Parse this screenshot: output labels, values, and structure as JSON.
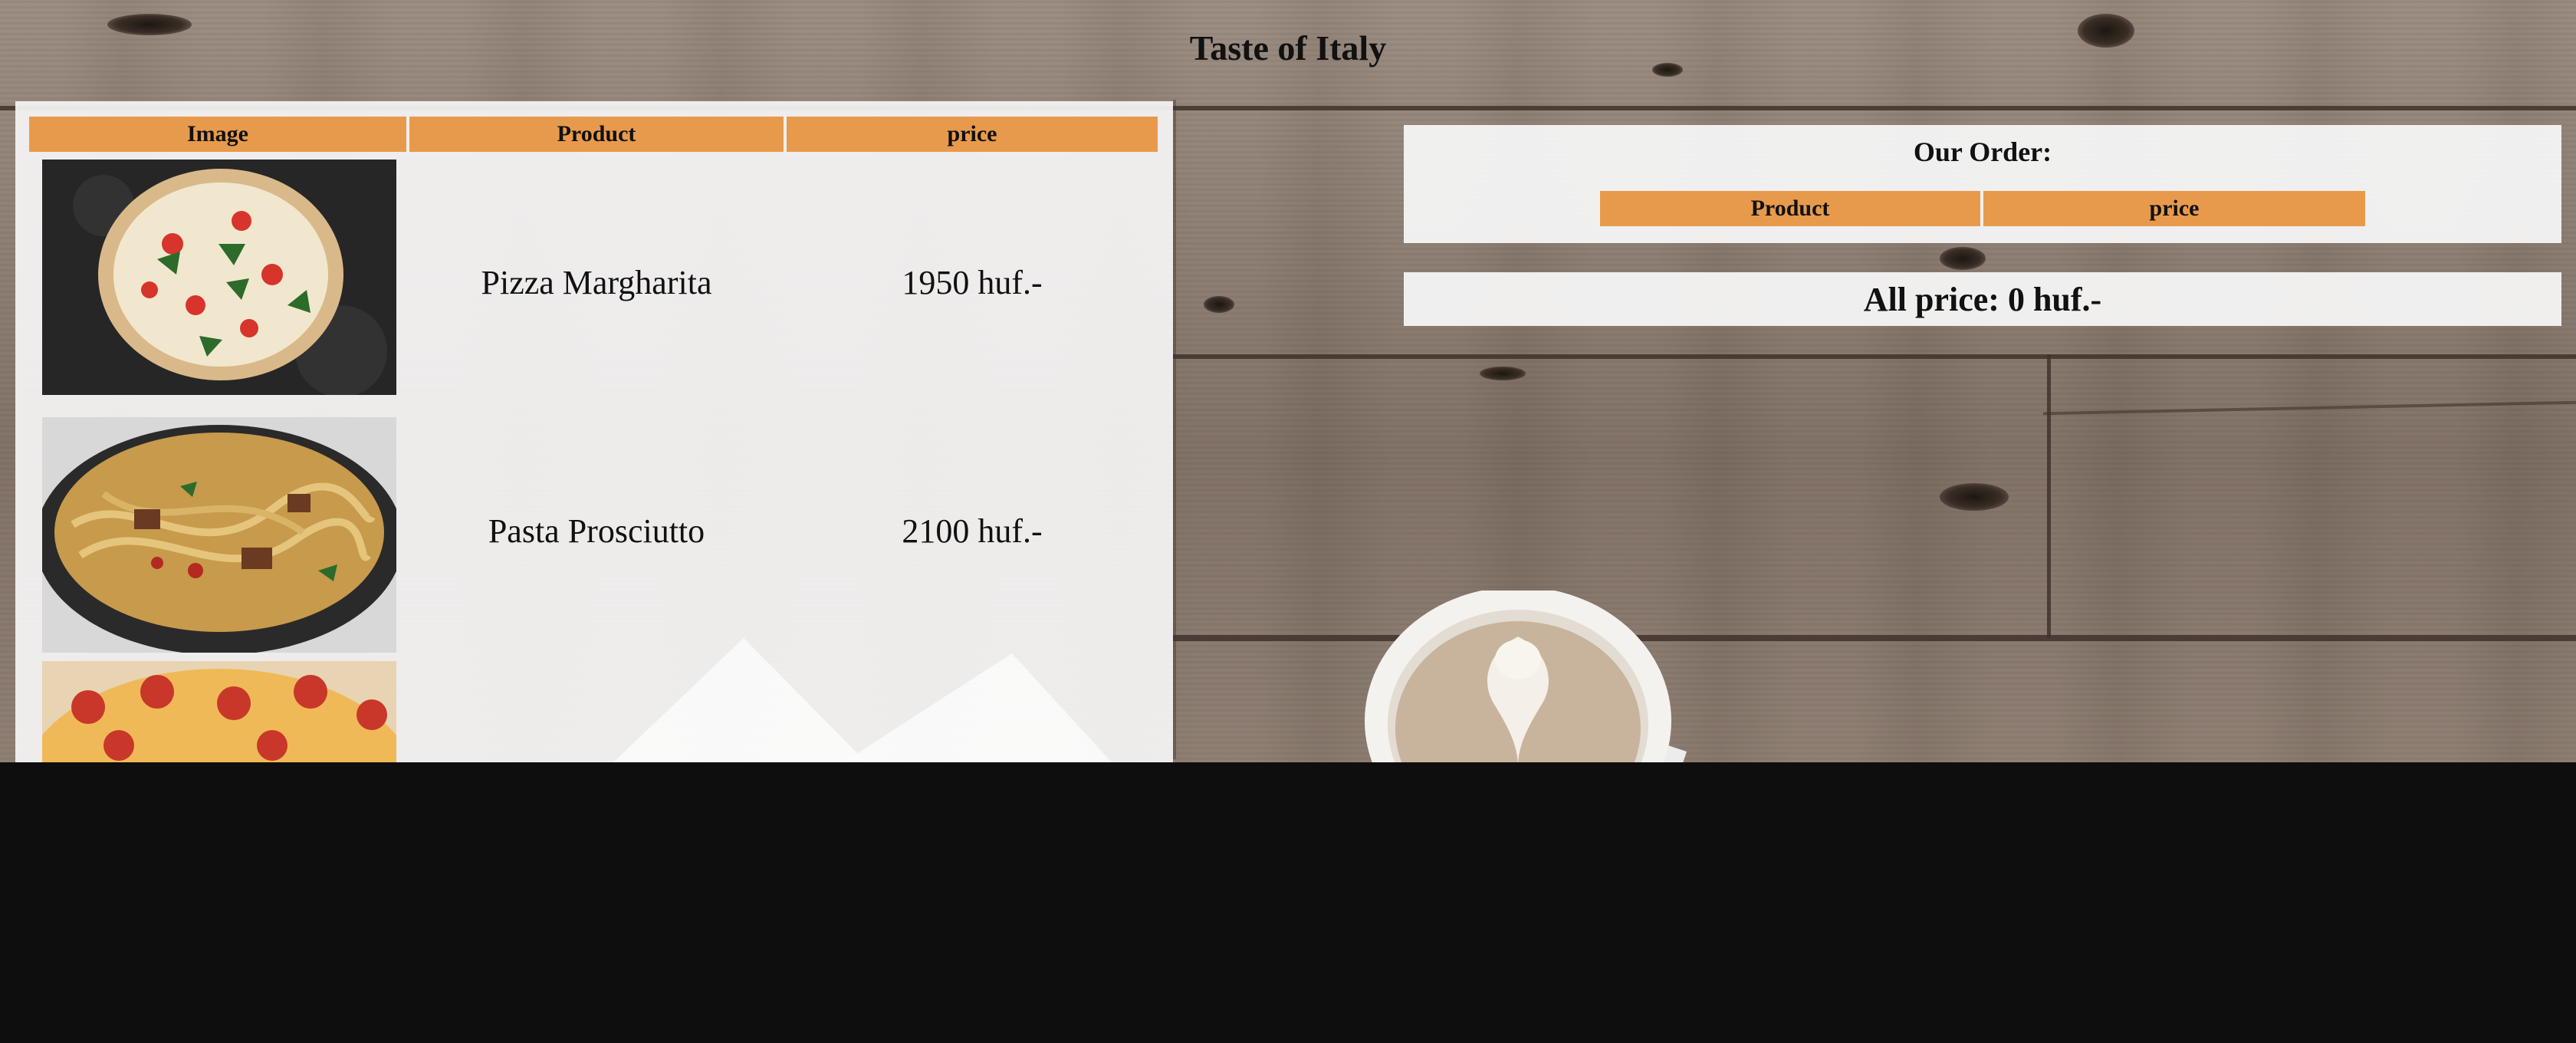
{
  "page": {
    "title": "Taste of Italy"
  },
  "menu": {
    "headers": {
      "image": "Image",
      "product": "Product",
      "price": "price"
    },
    "items": [
      {
        "name": "Pizza Margharita",
        "price": "1950 huf.-",
        "image_icon": "pizza-margherita-photo"
      },
      {
        "name": "Pasta Prosciutto",
        "price": "2100 huf.-",
        "image_icon": "pasta-prosciutto-photo"
      },
      {
        "name": "",
        "price": "",
        "image_icon": "pepperoni-pizza-photo"
      }
    ]
  },
  "order": {
    "title": "Our Order:",
    "headers": {
      "product": "Product",
      "price": "price"
    },
    "total_label": "All price: 0 huf.-"
  },
  "colors": {
    "header_orange": "#e89a4c",
    "panel": "#f6f6f6",
    "below_fold": "#0e0e0e"
  }
}
